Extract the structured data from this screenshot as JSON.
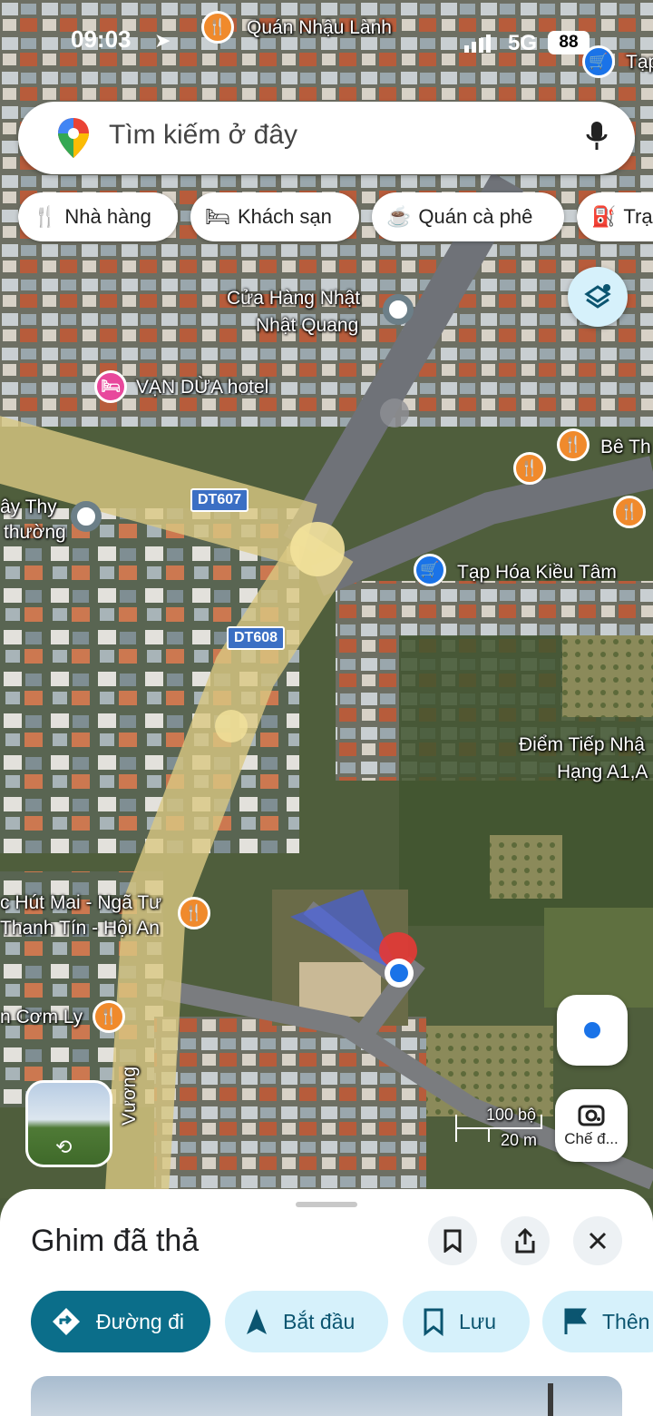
{
  "status_bar": {
    "time": "09:03",
    "network": "5G",
    "battery": "88"
  },
  "search": {
    "placeholder": "Tìm kiếm ở đây"
  },
  "chips": [
    {
      "label": "Nhà hàng",
      "icon": "restaurant-icon"
    },
    {
      "label": "Khách sạn",
      "icon": "hotel-icon"
    },
    {
      "label": "Quán cà phê",
      "icon": "coffee-icon"
    },
    {
      "label": "Trạ",
      "icon": "gas-station-icon"
    }
  ],
  "map": {
    "roads": {
      "dt607": "DT607",
      "dt608": "DT608",
      "vuong": "Vương"
    },
    "places": {
      "quan_nhau": "Quán Nhậu Lành",
      "tap_top": "Tạp",
      "cua_hang_1": "Cửa Hàng Nhật",
      "cua_hang_2": "Nhật Quang",
      "hotel": "VẠN DỪA hotel",
      "bethi": "Bê Th",
      "ay_thy_1": "ây Thy",
      "ay_thy_2": "thường",
      "tap_hoa": "Tạp Hóa Kiều Tâm",
      "diem_1": "Điểm Tiếp Nhậ",
      "diem_2": "Hạng A1,A",
      "hut_mai_1": "c Hút Mai - Ngã Tư",
      "hut_mai_2": "Thanh Tín - Hội An",
      "com_ly": "n Cơm Ly"
    },
    "scale": {
      "feet": "100 bộ",
      "meters": "20 m"
    },
    "lens_label": "Chế đ..."
  },
  "sheet": {
    "title": "Ghim đã thả",
    "actions": [
      {
        "label": "Đường đi",
        "icon": "directions-icon"
      },
      {
        "label": "Bắt đầu",
        "icon": "navigation-arrow-icon"
      },
      {
        "label": "Lưu",
        "icon": "bookmark-icon"
      },
      {
        "label": "Thên",
        "icon": "flag-icon"
      }
    ]
  },
  "colors": {
    "accent": "#0b6e8a",
    "chip_light": "#d6f1fb",
    "pin_red": "#e53935",
    "location_blue": "#1a73e8"
  }
}
